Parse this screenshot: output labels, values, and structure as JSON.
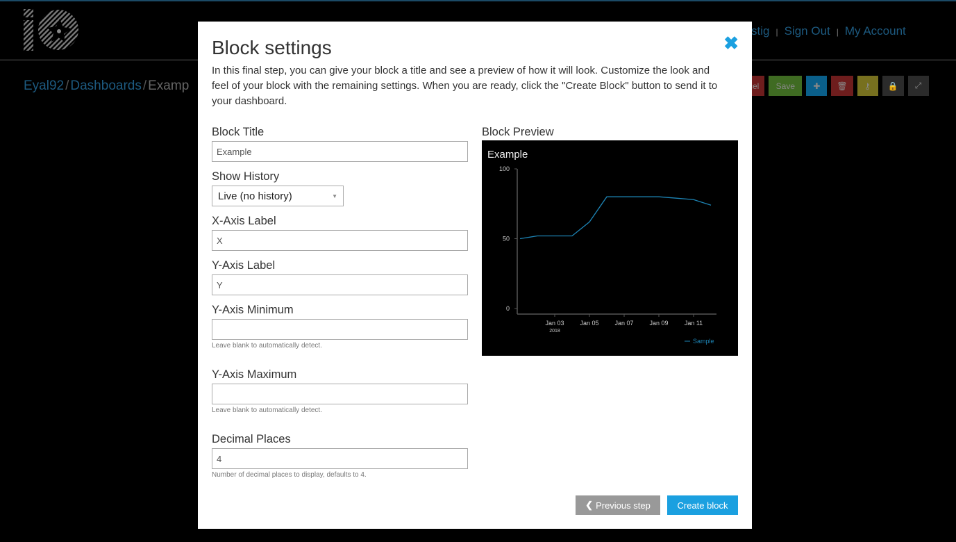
{
  "header": {
    "links": [
      {
        "label": "stig"
      },
      {
        "label": "Sign Out"
      },
      {
        "label": "My Account"
      }
    ],
    "separator": "|"
  },
  "breadcrumb": {
    "items": [
      "Eyal92",
      "Dashboards",
      "Examp"
    ],
    "separator": "/"
  },
  "toolbar": {
    "cancel_label": "cel",
    "save_label": "Save",
    "buttons": [
      {
        "icon": "plus-icon",
        "color": "#0a5f8a"
      },
      {
        "icon": "trash-icon",
        "color": "#6e1d1d"
      },
      {
        "icon": "key-icon",
        "color": "#77701f"
      },
      {
        "icon": "lock-icon",
        "color": "#2b2b2b"
      },
      {
        "icon": "expand-icon",
        "color": "#2b2b2b"
      }
    ]
  },
  "modal": {
    "title": "Block settings",
    "close_icon": "close-icon",
    "intro": "In this final step, you can give your block a title and see a preview of how it will look. Customize the look and feel of your block with the remaining settings. When you are ready, click the \"Create Block\" button to send it to your dashboard.",
    "fields": {
      "block_title": {
        "label": "Block Title",
        "value": "Example"
      },
      "show_history": {
        "label": "Show History",
        "value": "Live (no history)"
      },
      "x_label": {
        "label": "X-Axis Label",
        "value": "X"
      },
      "y_label": {
        "label": "Y-Axis Label",
        "value": "Y"
      },
      "y_min": {
        "label": "Y-Axis Minimum",
        "value": "",
        "help": "Leave blank to automatically detect."
      },
      "y_max": {
        "label": "Y-Axis Maximum",
        "value": "",
        "help": "Leave blank to automatically detect."
      },
      "decimals": {
        "label": "Decimal Places",
        "value": "4",
        "help": "Number of decimal places to display, defaults to 4."
      }
    },
    "preview_label": "Block Preview",
    "prev_button": "Previous step",
    "create_button": "Create block"
  },
  "chart_data": {
    "type": "line",
    "title": "Example",
    "x": [
      "2018-01-01",
      "2018-01-02",
      "2018-01-03",
      "2018-01-04",
      "2018-01-05",
      "2018-01-06",
      "2018-01-07",
      "2018-01-08",
      "2018-01-09",
      "2018-01-10",
      "2018-01-11",
      "2018-01-12"
    ],
    "series": [
      {
        "name": "Sample",
        "values": [
          50,
          52,
          52,
          52,
          62,
          80,
          80,
          80,
          80,
          79,
          78,
          74
        ],
        "color": "#1d84b5"
      }
    ],
    "ylim": [
      0,
      100
    ],
    "yticks": [
      "0",
      "50",
      "100"
    ],
    "xticks": [
      "Jan 03",
      "Jan 05",
      "Jan 07",
      "Jan 09",
      "Jan 11"
    ],
    "xtick_sub": "2018",
    "legend": "bottom-right"
  }
}
